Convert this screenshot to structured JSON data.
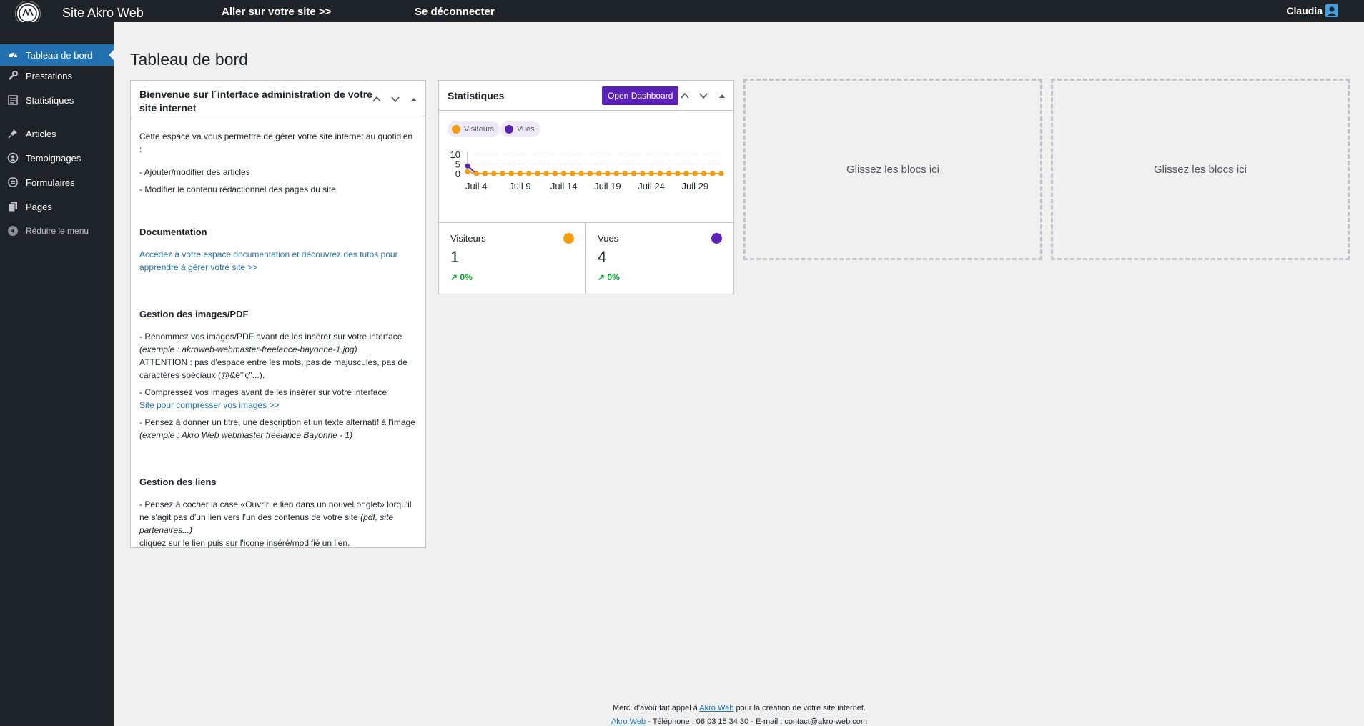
{
  "topbar": {
    "site_title": "Site Akro Web",
    "visit_link": "Aller sur votre site >>",
    "logout_link": "Se déconnecter",
    "user_name": "Claudia"
  },
  "sidebar": {
    "items": [
      {
        "label": "Tableau de bord",
        "icon": "dashboard-icon",
        "active": true
      },
      {
        "label": "Prestations",
        "icon": "wrench-icon"
      },
      {
        "label": "Statistiques",
        "icon": "stats-icon"
      },
      {
        "label": "Articles",
        "icon": "pin-icon"
      },
      {
        "label": "Temoignages",
        "icon": "testimonial-icon"
      },
      {
        "label": "Formulaires",
        "icon": "form-icon"
      },
      {
        "label": "Pages",
        "icon": "pages-icon"
      },
      {
        "label": "Réduire le menu",
        "icon": "collapse-icon"
      }
    ]
  },
  "page_title": "Tableau de bord",
  "welcome": {
    "title": "Bienvenue sur l´interface administration de votre site internet",
    "intro": "Cette espace va vous permettre de gérer votre site internet au quotidien :",
    "bullet1": "- Ajouter/modifier des articles",
    "bullet2": "- Modifier le contenu rédactionnel des pages du site",
    "doc_heading": "Documentation",
    "doc_link": "Accédez à votre espace documentation et découvrez des tutos pour apprendre à gérer votre site >>",
    "images_heading": "Gestion des images/PDF",
    "images_p1": "- Renommez vos images/PDF avant de les insérer sur votre interface",
    "images_p1_em": "(exemple : akroweb-webmaster-freelance-bayonne-1.jpg)",
    "images_attention": "ATTENTION : pas d'espace entre les mots, pas de majuscules, pas de caractères spéciaux (@&é\"'ç\"...).",
    "images_p2": "- Compressez vos images avant de les insérer sur votre interface",
    "images_compress_link": "Site pour compresser vos images >>",
    "images_p3": "- Pensez à donner un titre, une description et un texte alternatif à l'image",
    "images_p3_em": "(exemple : Akro Web webmaster freelance Bayonne - 1)",
    "links_heading": "Gestion des liens",
    "links_p1": "- Pensez à cocher la case «Ouvrir le lien dans un nouvel onglet» lorqu'il ne s'agit pas d'un lien vers l'un des contenus de votre site",
    "links_p1_em": "(pdf, site partenaires...)",
    "links_p2": "cliquez sur le lien puis sur l'icone inséré/modifié un lien."
  },
  "stats": {
    "title": "Statistiques",
    "open_dashboard": "Open Dashboard",
    "visitors_label": "Visiteurs",
    "visitors_value": "1",
    "visitors_delta": "0%",
    "views_label": "Vues",
    "views_value": "4",
    "views_delta": "0%",
    "colors": {
      "visitors": "#f59e0b",
      "views": "#5b21b6"
    }
  },
  "chart_data": {
    "type": "line",
    "x": [
      "Juil 3",
      "Juil 4",
      "Juil 5",
      "Juil 6",
      "Juil 7",
      "Juil 8",
      "Juil 9",
      "Juil 10",
      "Juil 11",
      "Juil 12",
      "Juil 13",
      "Juil 14",
      "Juil 15",
      "Juil 16",
      "Juil 17",
      "Juil 18",
      "Juil 19",
      "Juil 20",
      "Juil 21",
      "Juil 22",
      "Juil 23",
      "Juil 24",
      "Juil 25",
      "Juil 26",
      "Juil 27",
      "Juil 28",
      "Juil 29",
      "Juil 30",
      "Juil 31",
      "Août 1"
    ],
    "tick_labels": [
      "Juil 4",
      "Juil 9",
      "Juil 14",
      "Juil 19",
      "Juil 24",
      "Juil 29"
    ],
    "y_ticks": [
      "10",
      "5",
      "0"
    ],
    "ylim": [
      0,
      10
    ],
    "series": [
      {
        "name": "Visiteurs",
        "color": "#f59e0b",
        "values": [
          1,
          0,
          0,
          0,
          0,
          0,
          0,
          0,
          0,
          0,
          0,
          0,
          0,
          0,
          0,
          0,
          0,
          0,
          0,
          0,
          0,
          0,
          0,
          0,
          0,
          0,
          0,
          0,
          0,
          0
        ]
      },
      {
        "name": "Vues",
        "color": "#5b21b6",
        "values": [
          4,
          0,
          0,
          0,
          0,
          0,
          0,
          0,
          0,
          0,
          0,
          0,
          0,
          0,
          0,
          0,
          0,
          0,
          0,
          0,
          0,
          0,
          0,
          0,
          0,
          0,
          0,
          0,
          0,
          0
        ]
      }
    ]
  },
  "dropzones": {
    "label1": "Glissez les blocs ici",
    "label2": "Glissez les blocs ici"
  },
  "footer": {
    "line1_pre": "Merci d'avoir fait appel à",
    "line1_link": "Akro Web",
    "line1_post": "pour la création de votre site internet.",
    "line2_link": "Akro Web",
    "line2_post": "- Téléphone : 06 03 15 34 30 - E-mail : contact@akro-web.com"
  }
}
